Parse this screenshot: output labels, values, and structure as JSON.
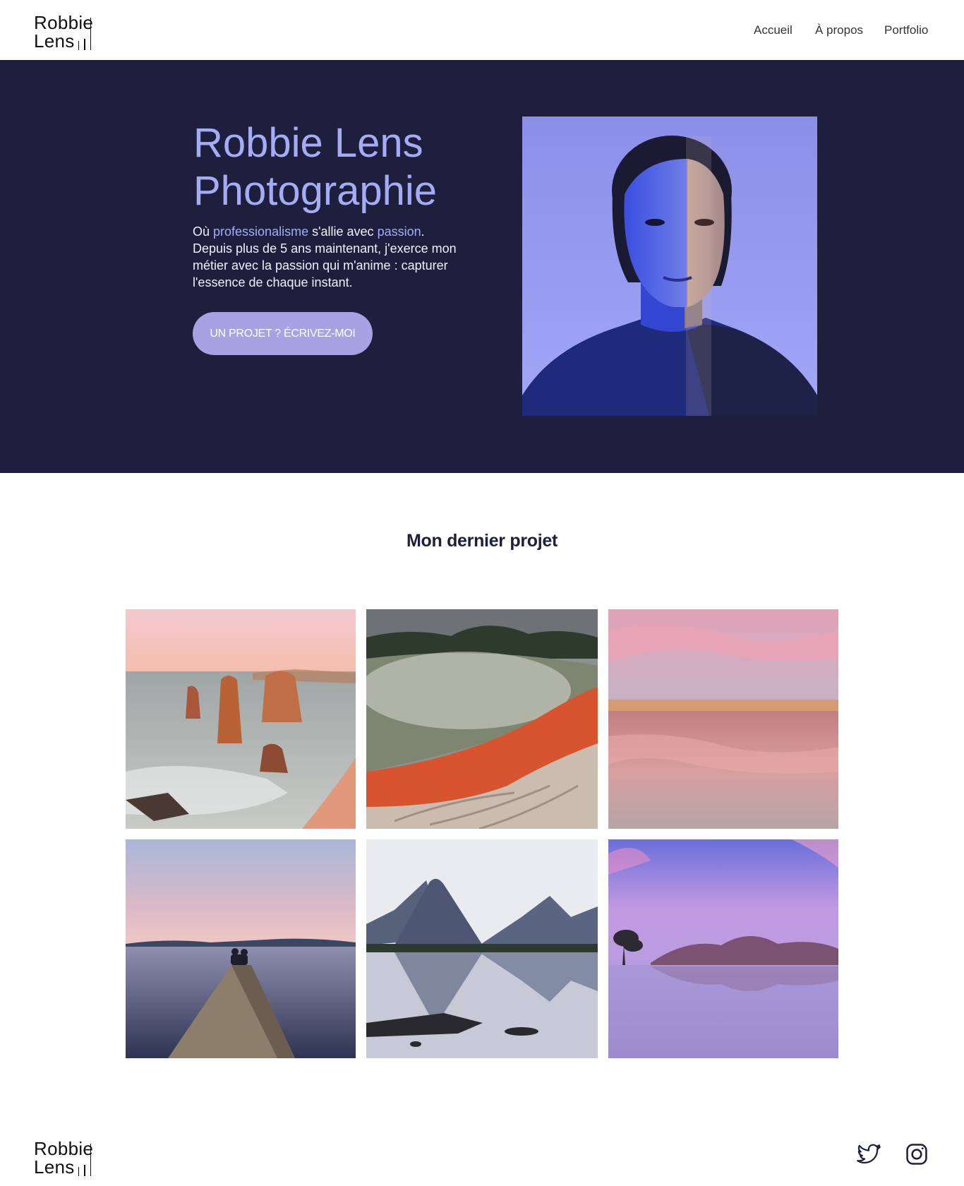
{
  "header": {
    "logo_line1": "Robbie",
    "logo_line2": "Lens",
    "nav": [
      "Accueil",
      "À propos",
      "Portfolio"
    ]
  },
  "hero": {
    "title_line1": "Robbie Lens",
    "title_line2": "Photographie",
    "desc_part1": "Où ",
    "desc_hl1": "professionalisme",
    "desc_part2": " s'allie avec ",
    "desc_hl2": "passion",
    "desc_part3": ".",
    "desc_rest": "Depuis plus de 5 ans maintenant, j'exerce mon métier avec la passion qui m'anime : capturer l'essence de chaque instant.",
    "cta": "UN PROJET ? ÉCRIVEZ-MOI"
  },
  "gallery": {
    "title": "Mon dernier projet"
  },
  "footer": {
    "logo_line1": "Robbie",
    "logo_line2": "Lens",
    "social": [
      "twitter-icon",
      "instagram-icon"
    ]
  },
  "colors": {
    "hero_bg": "#1e1f3d",
    "accent": "#a5acf5",
    "button": "#a7a2e2"
  }
}
